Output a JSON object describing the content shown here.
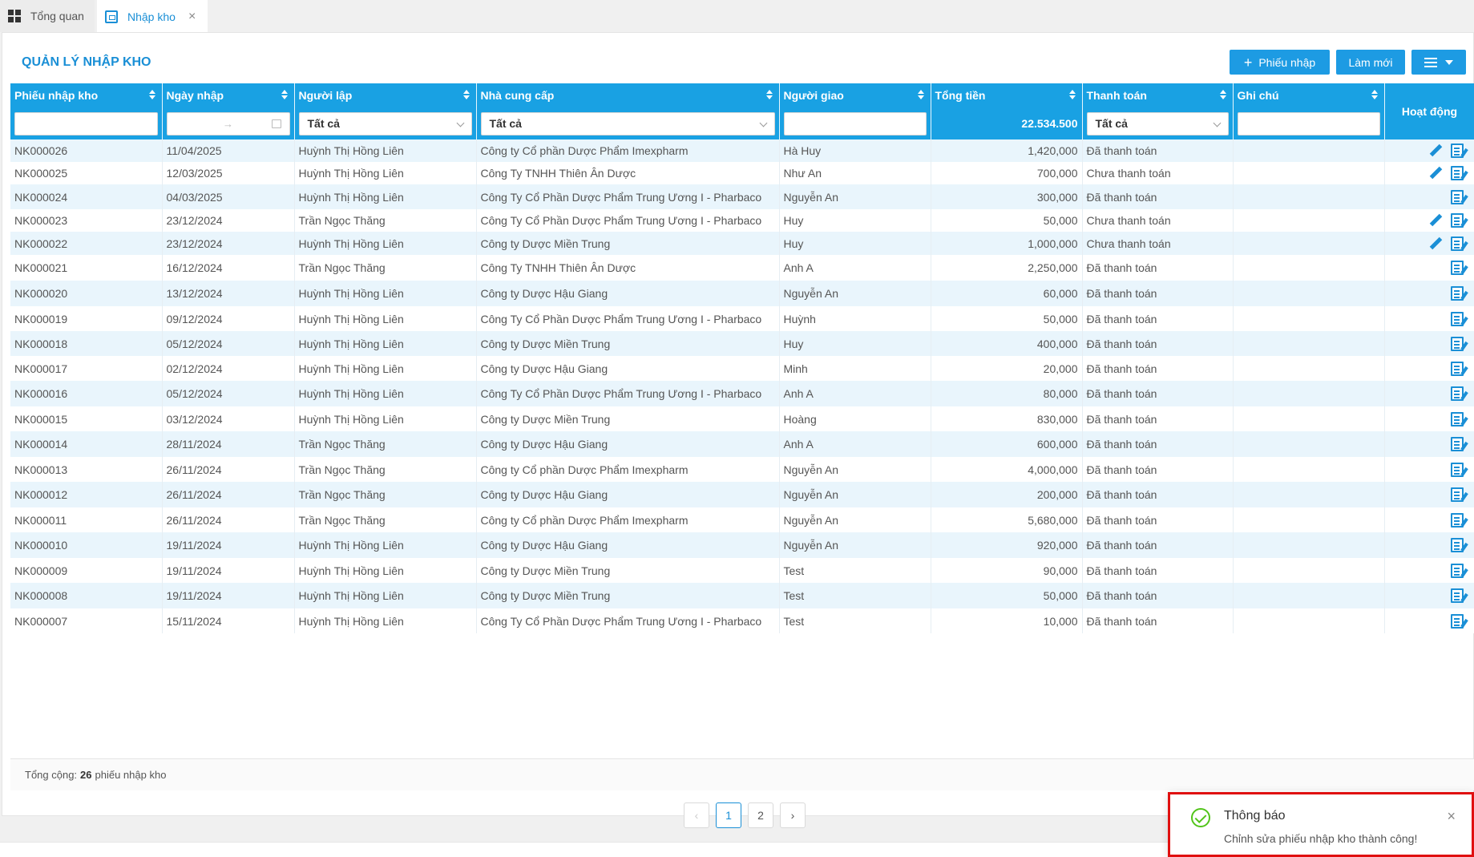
{
  "tabs": [
    {
      "label": "Tổng quan",
      "icon": "dashboard-icon"
    },
    {
      "label": "Nhập kho",
      "icon": "warehouse-icon"
    }
  ],
  "page": {
    "title": "QUẢN LÝ NHẬP KHO",
    "add_button": "Phiếu nhập",
    "refresh_button": "Làm mới"
  },
  "columns": {
    "code": "Phiếu nhập kho",
    "date": "Ngày nhập",
    "creator": "Người lập",
    "supplier": "Nhà cung cấp",
    "deliverer": "Người giao",
    "total": "Tổng tiền",
    "payment": "Thanh toán",
    "note": "Ghi chú",
    "actions": "Hoạt động"
  },
  "filters": {
    "creator": "Tất cả",
    "supplier": "Tất cả",
    "payment": "Tất cả",
    "date_separator": "→",
    "total_sum": "22.534.500"
  },
  "rows": [
    {
      "code": "NK000026",
      "date": "11/04/2025",
      "creator": "Huỳnh Thị Hồng Liên",
      "supplier": "Công ty Cổ phần Dược Phẩm Imexpharm",
      "deliverer": "Hà Huy",
      "total": "1,420,000",
      "payment": "Đã thanh toán",
      "editable": true
    },
    {
      "code": "NK000025",
      "date": "12/03/2025",
      "creator": "Huỳnh Thị Hồng Liên",
      "supplier": "Công Ty TNHH Thiên Ân Dược",
      "deliverer": "Như An",
      "total": "700,000",
      "payment": "Chưa thanh toán",
      "editable": true
    },
    {
      "code": "NK000024",
      "date": "04/03/2025",
      "creator": "Huỳnh Thị Hồng Liên",
      "supplier": "Công Ty Cổ Phần Dược Phẩm Trung Ương I - Pharbaco",
      "deliverer": "Nguyễn An",
      "total": "300,000",
      "payment": "Đã thanh toán",
      "editable": false
    },
    {
      "code": "NK000023",
      "date": "23/12/2024",
      "creator": "Trần Ngọc Thăng",
      "supplier": "Công Ty Cổ Phần Dược Phẩm Trung Ương I - Pharbaco",
      "deliverer": "Huy",
      "total": "50,000",
      "payment": "Chưa thanh toán",
      "editable": true
    },
    {
      "code": "NK000022",
      "date": "23/12/2024",
      "creator": "Huỳnh Thị Hồng Liên",
      "supplier": "Công ty Dược Miền Trung",
      "deliverer": "Huy",
      "total": "1,000,000",
      "payment": "Chưa thanh toán",
      "editable": true
    },
    {
      "code": "NK000021",
      "date": "16/12/2024",
      "creator": "Trần Ngọc Thăng",
      "supplier": "Công Ty TNHH Thiên Ân Dược",
      "deliverer": "Anh A",
      "total": "2,250,000",
      "payment": "Đã thanh toán",
      "editable": false
    },
    {
      "code": "NK000020",
      "date": "13/12/2024",
      "creator": "Huỳnh Thị Hồng Liên",
      "supplier": "Công ty Dược Hậu Giang",
      "deliverer": "Nguyễn An",
      "total": "60,000",
      "payment": "Đã thanh toán",
      "editable": false
    },
    {
      "code": "NK000019",
      "date": "09/12/2024",
      "creator": "Huỳnh Thị Hồng Liên",
      "supplier": "Công Ty Cổ Phần Dược Phẩm Trung Ương I - Pharbaco",
      "deliverer": "Huỳnh",
      "total": "50,000",
      "payment": "Đã thanh toán",
      "editable": false
    },
    {
      "code": "NK000018",
      "date": "05/12/2024",
      "creator": "Huỳnh Thị Hồng Liên",
      "supplier": "Công ty Dược Miền Trung",
      "deliverer": "Huy",
      "total": "400,000",
      "payment": "Đã thanh toán",
      "editable": false
    },
    {
      "code": "NK000017",
      "date": "02/12/2024",
      "creator": "Huỳnh Thị Hồng Liên",
      "supplier": "Công ty Dược Hậu Giang",
      "deliverer": "Minh",
      "total": "20,000",
      "payment": "Đã thanh toán",
      "editable": false
    },
    {
      "code": "NK000016",
      "date": "05/12/2024",
      "creator": "Huỳnh Thị Hồng Liên",
      "supplier": "Công Ty Cổ Phần Dược Phẩm Trung Ương I - Pharbaco",
      "deliverer": "Anh A",
      "total": "80,000",
      "payment": "Đã thanh toán",
      "editable": false
    },
    {
      "code": "NK000015",
      "date": "03/12/2024",
      "creator": "Huỳnh Thị Hồng Liên",
      "supplier": "Công ty Dược Miền Trung",
      "deliverer": "Hoàng",
      "total": "830,000",
      "payment": "Đã thanh toán",
      "editable": false
    },
    {
      "code": "NK000014",
      "date": "28/11/2024",
      "creator": "Trần Ngọc Thăng",
      "supplier": "Công ty Dược Hậu Giang",
      "deliverer": "Anh A",
      "total": "600,000",
      "payment": "Đã thanh toán",
      "editable": false
    },
    {
      "code": "NK000013",
      "date": "26/11/2024",
      "creator": "Trần Ngọc Thăng",
      "supplier": "Công ty Cổ phần Dược Phẩm Imexpharm",
      "deliverer": "Nguyễn An",
      "total": "4,000,000",
      "payment": "Đã thanh toán",
      "editable": false
    },
    {
      "code": "NK000012",
      "date": "26/11/2024",
      "creator": "Trần Ngọc Thăng",
      "supplier": "Công ty Dược Hậu Giang",
      "deliverer": "Nguyễn An",
      "total": "200,000",
      "payment": "Đã thanh toán",
      "editable": false
    },
    {
      "code": "NK000011",
      "date": "26/11/2024",
      "creator": "Trần Ngọc Thăng",
      "supplier": "Công ty Cổ phần Dược Phẩm Imexpharm",
      "deliverer": "Nguyễn An",
      "total": "5,680,000",
      "payment": "Đã thanh toán",
      "editable": false
    },
    {
      "code": "NK000010",
      "date": "19/11/2024",
      "creator": "Huỳnh Thị Hồng Liên",
      "supplier": "Công ty Dược Hậu Giang",
      "deliverer": "Nguyễn An",
      "total": "920,000",
      "payment": "Đã thanh toán",
      "editable": false
    },
    {
      "code": "NK000009",
      "date": "19/11/2024",
      "creator": "Huỳnh Thị Hồng Liên",
      "supplier": "Công ty Dược Miền Trung",
      "deliverer": "Test",
      "total": "90,000",
      "payment": "Đã thanh toán",
      "editable": false
    },
    {
      "code": "NK000008",
      "date": "19/11/2024",
      "creator": "Huỳnh Thị Hồng Liên",
      "supplier": "Công ty Dược Miền Trung",
      "deliverer": "Test",
      "total": "50,000",
      "payment": "Đã thanh toán",
      "editable": false
    },
    {
      "code": "NK000007",
      "date": "15/11/2024",
      "creator": "Huỳnh Thị Hồng Liên",
      "supplier": "Công Ty Cổ Phần Dược Phẩm Trung Ương I - Pharbaco",
      "deliverer": "Test",
      "total": "10,000",
      "payment": "Đã thanh toán",
      "editable": false
    }
  ],
  "footer": {
    "prefix": "Tổng cộng:",
    "count": "26",
    "suffix": "phiếu nhập kho"
  },
  "pagination": {
    "prev": "‹",
    "pages": [
      "1",
      "2"
    ],
    "current": "1",
    "next": "›"
  },
  "toast": {
    "title": "Thông báo",
    "message": "Chỉnh sửa phiếu nhập kho thành công!",
    "close": "×"
  },
  "colors": {
    "accent": "#1a8fd6",
    "header": "#19a1e3",
    "row_alt": "#e9f5fc",
    "success": "#52c41a",
    "highlight": "#e01010"
  }
}
